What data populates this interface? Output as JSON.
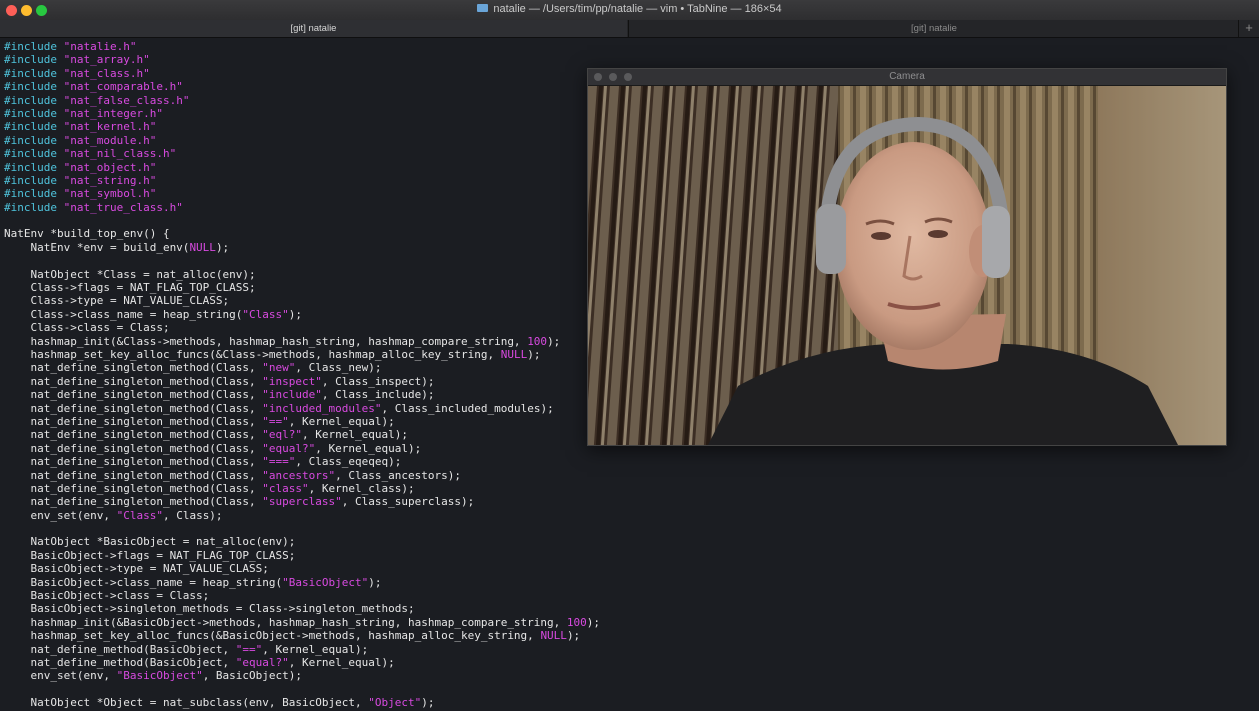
{
  "window": {
    "title": "natalie — /Users/tim/pp/natalie — vim • TabNine — 186×54"
  },
  "tabs": [
    {
      "label": "[git] natalie"
    },
    {
      "label": "[git] natalie"
    }
  ],
  "tab_add_label": "+",
  "camera": {
    "title": "Camera"
  },
  "code_lines": [
    [
      [
        "pp",
        "#include "
      ],
      [
        "str",
        "\"natalie.h\""
      ]
    ],
    [
      [
        "pp",
        "#include "
      ],
      [
        "str",
        "\"nat_array.h\""
      ]
    ],
    [
      [
        "pp",
        "#include "
      ],
      [
        "str",
        "\"nat_class.h\""
      ]
    ],
    [
      [
        "pp",
        "#include "
      ],
      [
        "str",
        "\"nat_comparable.h\""
      ]
    ],
    [
      [
        "pp",
        "#include "
      ],
      [
        "str",
        "\"nat_false_class.h\""
      ]
    ],
    [
      [
        "pp",
        "#include "
      ],
      [
        "str",
        "\"nat_integer.h\""
      ]
    ],
    [
      [
        "pp",
        "#include "
      ],
      [
        "str",
        "\"nat_kernel.h\""
      ]
    ],
    [
      [
        "pp",
        "#include "
      ],
      [
        "str",
        "\"nat_module.h\""
      ]
    ],
    [
      [
        "pp",
        "#include "
      ],
      [
        "str",
        "\"nat_nil_class.h\""
      ]
    ],
    [
      [
        "pp",
        "#include "
      ],
      [
        "str",
        "\"nat_object.h\""
      ]
    ],
    [
      [
        "pp",
        "#include "
      ],
      [
        "str",
        "\"nat_string.h\""
      ]
    ],
    [
      [
        "pp",
        "#include "
      ],
      [
        "str",
        "\"nat_symbol.h\""
      ]
    ],
    [
      [
        "pp",
        "#include "
      ],
      [
        "str",
        "\"nat_true_class.h\""
      ]
    ],
    [],
    [
      [
        "t",
        "NatEnv *build_top_env() {"
      ]
    ],
    [
      [
        "t",
        "    NatEnv *env = build_env("
      ],
      [
        "num",
        "NULL"
      ],
      [
        "t",
        ");"
      ]
    ],
    [],
    [
      [
        "t",
        "    NatObject *Class = nat_alloc(env);"
      ]
    ],
    [
      [
        "t",
        "    Class->flags = NAT_FLAG_TOP_CLASS;"
      ]
    ],
    [
      [
        "t",
        "    Class->type = NAT_VALUE_CLASS;"
      ]
    ],
    [
      [
        "t",
        "    Class->class_name = heap_string("
      ],
      [
        "str",
        "\"Class\""
      ],
      [
        "t",
        ");"
      ]
    ],
    [
      [
        "t",
        "    Class->class = Class;"
      ]
    ],
    [
      [
        "t",
        "    hashmap_init(&Class->methods, hashmap_hash_string, hashmap_compare_string, "
      ],
      [
        "num",
        "100"
      ],
      [
        "t",
        ");"
      ]
    ],
    [
      [
        "t",
        "    hashmap_set_key_alloc_funcs(&Class->methods, hashmap_alloc_key_string, "
      ],
      [
        "num",
        "NULL"
      ],
      [
        "t",
        ");"
      ]
    ],
    [
      [
        "t",
        "    nat_define_singleton_method(Class, "
      ],
      [
        "str",
        "\"new\""
      ],
      [
        "t",
        ", Class_new);"
      ]
    ],
    [
      [
        "t",
        "    nat_define_singleton_method(Class, "
      ],
      [
        "str",
        "\"inspect\""
      ],
      [
        "t",
        ", Class_inspect);"
      ]
    ],
    [
      [
        "t",
        "    nat_define_singleton_method(Class, "
      ],
      [
        "str",
        "\"include\""
      ],
      [
        "t",
        ", Class_include);"
      ]
    ],
    [
      [
        "t",
        "    nat_define_singleton_method(Class, "
      ],
      [
        "str",
        "\"included_modules\""
      ],
      [
        "t",
        ", Class_included_modules);"
      ]
    ],
    [
      [
        "t",
        "    nat_define_singleton_method(Class, "
      ],
      [
        "str",
        "\"==\""
      ],
      [
        "t",
        ", Kernel_equal);"
      ]
    ],
    [
      [
        "t",
        "    nat_define_singleton_method(Class, "
      ],
      [
        "str",
        "\"eql?\""
      ],
      [
        "t",
        ", Kernel_equal);"
      ]
    ],
    [
      [
        "t",
        "    nat_define_singleton_method(Class, "
      ],
      [
        "str",
        "\"equal?\""
      ],
      [
        "t",
        ", Kernel_equal);"
      ]
    ],
    [
      [
        "t",
        "    nat_define_singleton_method(Class, "
      ],
      [
        "str",
        "\"===\""
      ],
      [
        "t",
        ", Class_eqeqeq);"
      ]
    ],
    [
      [
        "t",
        "    nat_define_singleton_method(Class, "
      ],
      [
        "str",
        "\"ancestors\""
      ],
      [
        "t",
        ", Class_ancestors);"
      ]
    ],
    [
      [
        "t",
        "    nat_define_singleton_method(Class, "
      ],
      [
        "str",
        "\"class\""
      ],
      [
        "t",
        ", Kernel_class);"
      ]
    ],
    [
      [
        "t",
        "    nat_define_singleton_method(Class, "
      ],
      [
        "str",
        "\"superclass\""
      ],
      [
        "t",
        ", Class_superclass);"
      ]
    ],
    [
      [
        "t",
        "    env_set(env, "
      ],
      [
        "str",
        "\"Class\""
      ],
      [
        "t",
        ", Class);"
      ]
    ],
    [],
    [
      [
        "t",
        "    NatObject *BasicObject = nat_alloc(env);"
      ]
    ],
    [
      [
        "t",
        "    BasicObject->flags = NAT_FLAG_TOP_CLASS;"
      ]
    ],
    [
      [
        "t",
        "    BasicObject->type = NAT_VALUE_CLASS;"
      ]
    ],
    [
      [
        "t",
        "    BasicObject->class_name = heap_string("
      ],
      [
        "str",
        "\"BasicObject\""
      ],
      [
        "t",
        ");"
      ]
    ],
    [
      [
        "t",
        "    BasicObject->class = Class;"
      ]
    ],
    [
      [
        "t",
        "    BasicObject->singleton_methods = Class->singleton_methods;"
      ]
    ],
    [
      [
        "t",
        "    hashmap_init(&BasicObject->methods, hashmap_hash_string, hashmap_compare_string, "
      ],
      [
        "num",
        "100"
      ],
      [
        "t",
        ");"
      ]
    ],
    [
      [
        "t",
        "    hashmap_set_key_alloc_funcs(&BasicObject->methods, hashmap_alloc_key_string, "
      ],
      [
        "num",
        "NULL"
      ],
      [
        "t",
        ");"
      ]
    ],
    [
      [
        "t",
        "    nat_define_method(BasicObject, "
      ],
      [
        "str",
        "\"==\""
      ],
      [
        "t",
        ", Kernel_equal);"
      ]
    ],
    [
      [
        "t",
        "    nat_define_method(BasicObject, "
      ],
      [
        "str",
        "\"equal?\""
      ],
      [
        "t",
        ", Kernel_equal);"
      ]
    ],
    [
      [
        "t",
        "    env_set(env, "
      ],
      [
        "str",
        "\"BasicObject\""
      ],
      [
        "t",
        ", BasicObject);"
      ]
    ],
    [],
    [
      [
        "t",
        "    NatObject *Object = nat_subclass(env, BasicObject, "
      ],
      [
        "str",
        "\"Object\""
      ],
      [
        "t",
        ");"
      ]
    ]
  ]
}
